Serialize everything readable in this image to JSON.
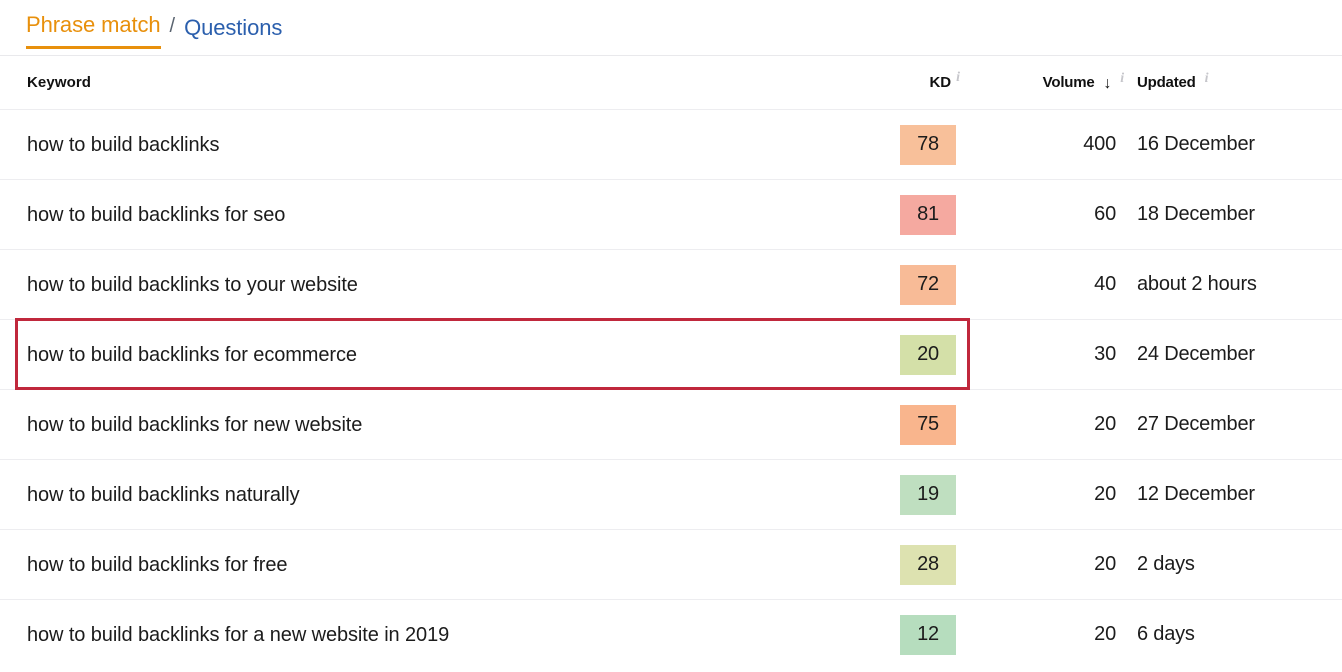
{
  "tabs": {
    "active_label": "Phrase match",
    "separator": "/",
    "link_label": "Questions"
  },
  "table": {
    "headers": {
      "keyword": "Keyword",
      "kd": "KD",
      "volume": "Volume",
      "updated": "Updated",
      "info_icon": "i",
      "sort_arrow": "↓"
    },
    "rows": [
      {
        "keyword": "how to build backlinks",
        "kd": "78",
        "kd_color": "#f8c09a",
        "volume": "400",
        "updated": "16 December"
      },
      {
        "keyword": "how to build backlinks for seo",
        "kd": "81",
        "kd_color": "#f5a9a0",
        "volume": "60",
        "updated": "18 December"
      },
      {
        "keyword": "how to build backlinks to your website",
        "kd": "72",
        "kd_color": "#f8bb97",
        "volume": "40",
        "updated": "about 2 hours"
      },
      {
        "keyword": "how to build backlinks for ecommerce",
        "kd": "20",
        "kd_color": "#d4e0a8",
        "volume": "30",
        "updated": "24 December"
      },
      {
        "keyword": "how to build backlinks for new website",
        "kd": "75",
        "kd_color": "#f9b58d",
        "volume": "20",
        "updated": "27 December"
      },
      {
        "keyword": "how to build backlinks naturally",
        "kd": "19",
        "kd_color": "#bfdfc0",
        "volume": "20",
        "updated": "12 December"
      },
      {
        "keyword": "how to build backlinks for free",
        "kd": "28",
        "kd_color": "#dde2b0",
        "volume": "20",
        "updated": "2 days"
      },
      {
        "keyword": "how to build backlinks for a new website in 2019",
        "kd": "12",
        "kd_color": "#b6ddbe",
        "volume": "20",
        "updated": "6 days"
      }
    ]
  },
  "annotation": {
    "highlight_row_index": 3,
    "highlight_color": "#c0283c"
  },
  "colors": {
    "accent_orange": "#e8900c",
    "link_blue": "#2b5fad",
    "separator": "#ededf0"
  }
}
